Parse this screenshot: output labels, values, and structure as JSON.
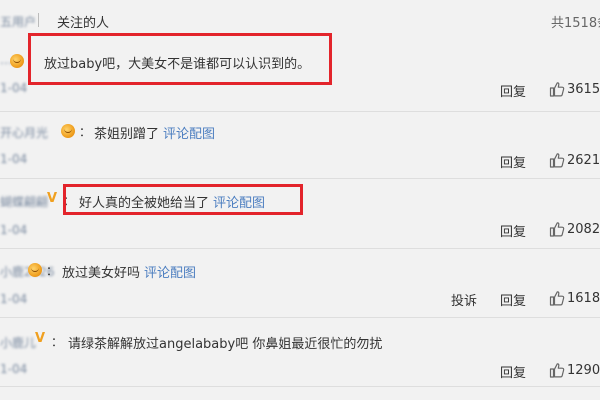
{
  "header": {
    "user_stub": "五用户",
    "title": "关注的人",
    "total": "共1518条"
  },
  "comments": [
    {
      "user": "…",
      "text": "放过baby吧，大美女不是谁都可以认识到的。",
      "time": "1-04",
      "reply": "回复",
      "likes": "3615"
    },
    {
      "user": "开心月光",
      "text": "茶姐别蹭了",
      "pic": "评论配图",
      "time": "1-04",
      "reply": "回复",
      "likes": "2621"
    },
    {
      "user": "蝴蝶翩翩",
      "text": "好人真的全被她给当了",
      "pic": "评论配图",
      "time": "1-04",
      "reply": "回复",
      "likes": "2082"
    },
    {
      "user": "小鹿2026",
      "text": "放过美女好吗",
      "pic": "评论配图",
      "time": "1-04",
      "report": "投诉",
      "reply": "回复",
      "likes": "1618"
    },
    {
      "user": "小鹿儿",
      "text": "请绿茶解解放过angelababy吧 你鼻姐最近很忙的勿扰",
      "time": "1-04",
      "reply": "回复",
      "likes": "1290"
    }
  ],
  "colors": {
    "highlight": "#e3242b",
    "link": "#4c7ec0",
    "badge": "#f0a020"
  },
  "icons": {
    "like": "thumbs-up-icon",
    "vip": "smile-badge-icon",
    "verified": "v-badge-icon"
  }
}
